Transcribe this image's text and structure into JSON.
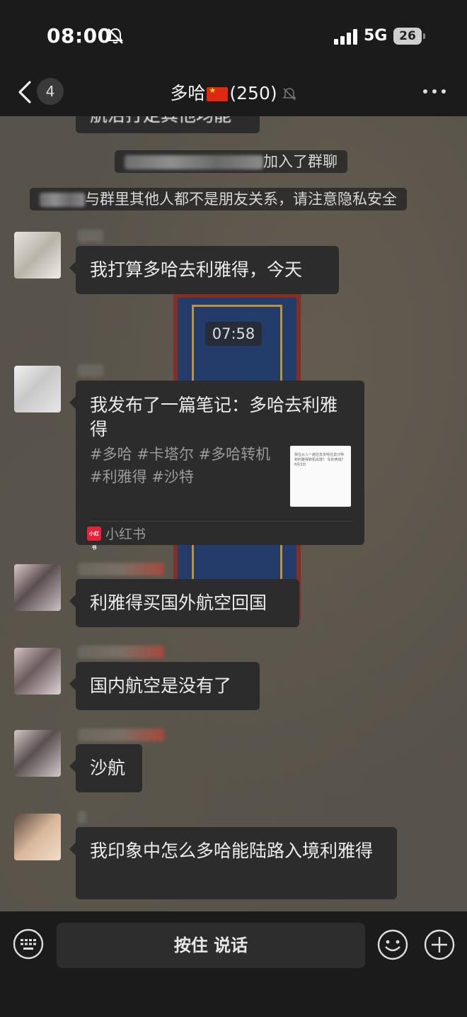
{
  "status_bar": {
    "time": "08:00",
    "network": "5G",
    "battery": "26"
  },
  "nav": {
    "unread_count": "4",
    "chat_name_prefix": "多哈",
    "member_count": "(250)"
  },
  "messages": {
    "partial_top": "航治打定其他均能",
    "system_join_suffix": "加入了群聊",
    "system_privacy": "与群里其他人都不是朋友关系，请注意隐私安全",
    "msg1": "我打算多哈去利雅得，今天",
    "timestamp": "07:58",
    "note": {
      "title": "我发布了一篇笔记：多哈去利雅得",
      "tags": "#多哈 #卡塔尔 #多哈转机 #利雅得 #沙特",
      "thumb_text": "我在从入一趟往去多哈往去沙特到利雅得转机出境？ 车的卖钱？ 8月3日",
      "logo_text": "小红书",
      "source": "小红书"
    },
    "msg2": "利雅得买国外航空回国",
    "msg3": "国内航空是没有了",
    "msg4": "沙航",
    "msg5": "我印象中怎么多哈能陆路入境利雅得"
  },
  "input_bar": {
    "voice_label": "按住 说话"
  },
  "colors": {
    "bar_bg": "#1b1b1b",
    "bubble_bg": "#2c2c2c",
    "chat_bg": "#57524a",
    "xhs_red": "#e62339"
  }
}
